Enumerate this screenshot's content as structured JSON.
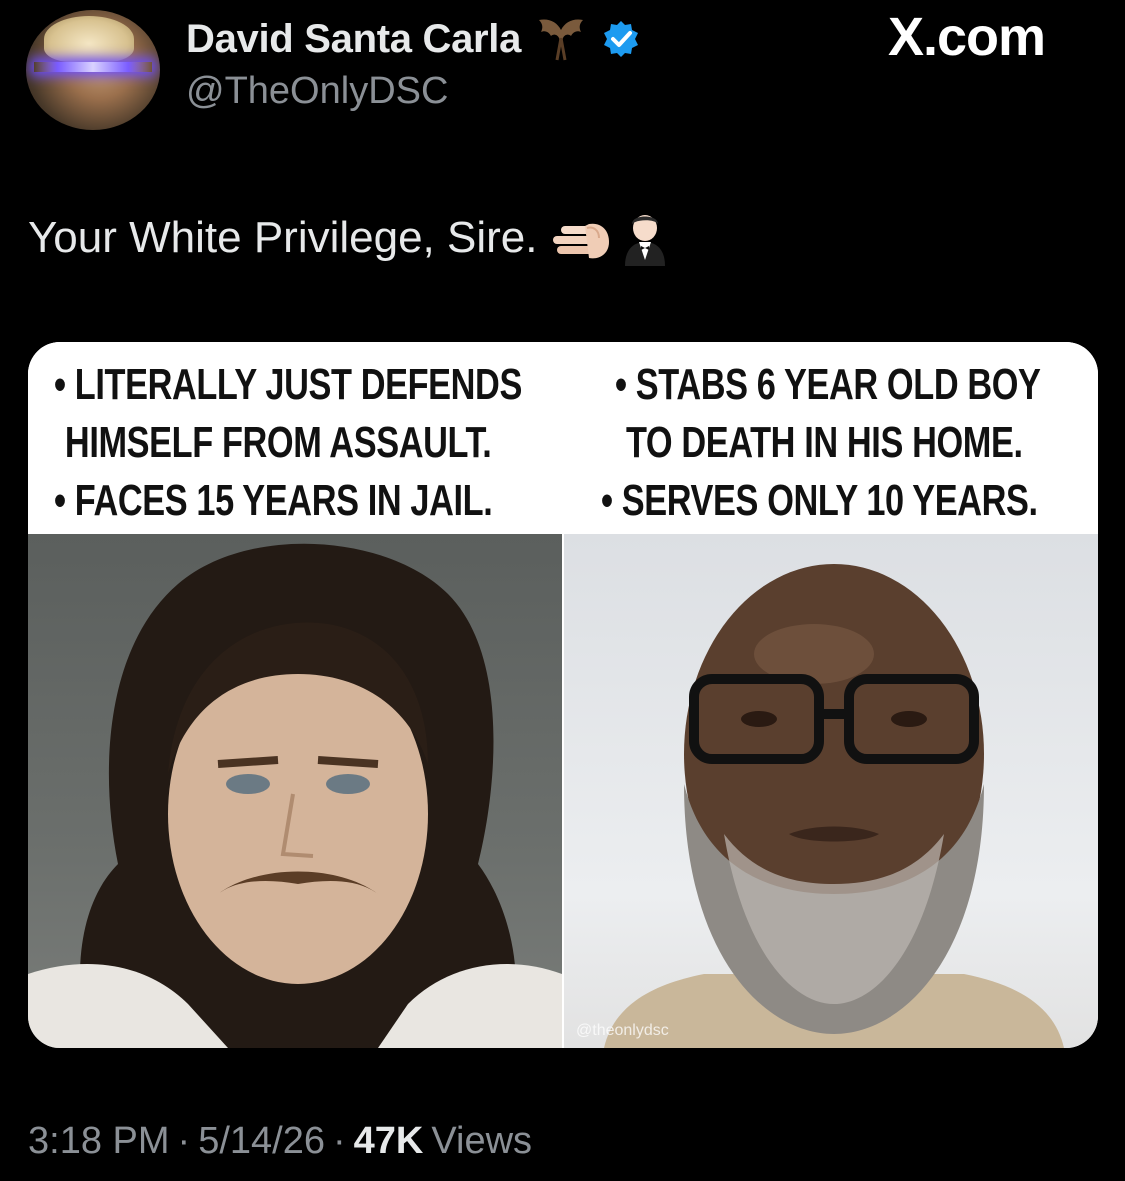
{
  "header": {
    "display_name": "David Santa Carla",
    "handle": "@TheOnlyDSC",
    "site_label": "X.com",
    "name_icons": [
      "bat-icon",
      "verified-badge-icon"
    ],
    "colors": {
      "verified": "#1d9bf0",
      "secondary_text": "#8b9096"
    }
  },
  "tweet": {
    "text": "Your White Privilege, Sire.",
    "emojis": [
      "right-facing-hand-emoji",
      "person-in-tuxedo-emoji"
    ]
  },
  "media": {
    "left_caption": [
      "• LITERALLY JUST DEFENDS",
      "HIMSELF FROM ASSAULT.",
      "• FACES 15 YEARS IN JAIL."
    ],
    "right_caption": [
      "• STABS 6 YEAR OLD BOY",
      "TO DEATH IN HIS HOME.",
      "• SERVES ONLY 10 YEARS."
    ],
    "watermark": "@theonlydsc",
    "left_photo": "mugshot-white-man-with-mustache",
    "right_photo": "mugshot-black-man-with-glasses-and-beard"
  },
  "footer": {
    "time": "3:18 PM",
    "sep1": "·",
    "date": "5/14/26",
    "sep2": "·",
    "views_count": "47K",
    "views_label": "Views"
  }
}
